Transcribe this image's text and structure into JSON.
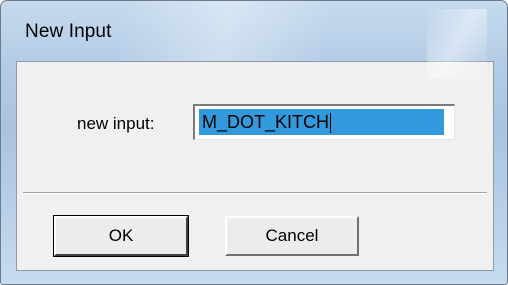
{
  "window": {
    "title": "New Input"
  },
  "form": {
    "label": "new input:",
    "input_value": "M_DOT_KITCH"
  },
  "buttons": {
    "ok_label": "OK",
    "cancel_label": "Cancel"
  },
  "colors": {
    "selection": "#3399dd",
    "dialog_background": "#f0f0f0",
    "frame": "#b5cde6"
  }
}
